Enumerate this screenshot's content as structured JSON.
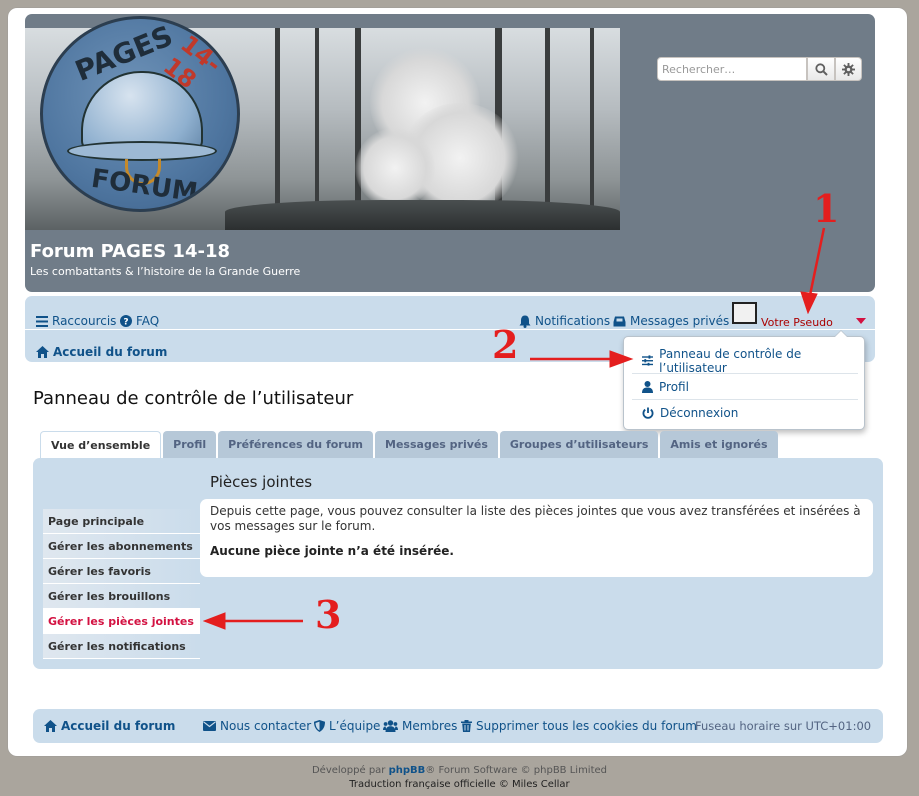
{
  "header": {
    "site_title": "Forum PAGES 14-18",
    "site_description": "Les combattants & l’histoire de la Grande Guerre",
    "logo_text": [
      "PAGES",
      "14-18",
      "FORUM"
    ],
    "search": {
      "placeholder": "Rechercher…"
    }
  },
  "navbar": {
    "quicklinks": "Raccourcis",
    "faq": "FAQ",
    "notifications": "Notifications",
    "private_messages": "Messages privés",
    "username": "Votre Pseudo",
    "breadcrumb_home": "Accueil du forum"
  },
  "user_dropdown": {
    "items": [
      {
        "label": "Panneau de contrôle de l’utilisateur",
        "icon": "sliders-icon"
      },
      {
        "label": "Profil",
        "icon": "user-icon"
      },
      {
        "label": "Déconnexion",
        "icon": "power-icon"
      }
    ]
  },
  "page": {
    "title": "Panneau de contrôle de l’utilisateur",
    "tabs": [
      "Vue d’ensemble",
      "Profil",
      "Préférences du forum",
      "Messages privés",
      "Groupes d’utilisateurs",
      "Amis et ignorés"
    ],
    "active_tab": 0,
    "menu": [
      "Page principale",
      "Gérer les abonnements",
      "Gérer les favoris",
      "Gérer les brouillons",
      "Gérer les pièces jointes",
      "Gérer les notifications"
    ],
    "active_menu": 4,
    "section_title": "Pièces jointes",
    "description": "Depuis cette page, vous pouvez consulter la liste des pièces jointes que vous avez transférées et insérées à vos messages sur le forum.",
    "empty_message": "Aucune pièce jointe n’a été insérée."
  },
  "footer": {
    "home": "Accueil du forum",
    "contact": "Nous contacter",
    "team": "L’équipe",
    "members": "Membres",
    "delete_cookies": "Supprimer tous les cookies du forum",
    "timezone": "Fuseau horaire sur UTC+01:00",
    "powered_prefix": "Développé par",
    "powered_brand": "phpBB",
    "powered_suffix": "® Forum Software © phpBB Limited",
    "translation": "Traduction française officielle © Miles Cellar"
  },
  "annotations": [
    "1",
    "2",
    "3"
  ],
  "colors": {
    "link": "#105289",
    "username": "#aa0000",
    "active_menu": "#d31141",
    "annotation": "#e41e1e",
    "header_bg": "#707c88",
    "panel_bg": "#cadceb"
  }
}
